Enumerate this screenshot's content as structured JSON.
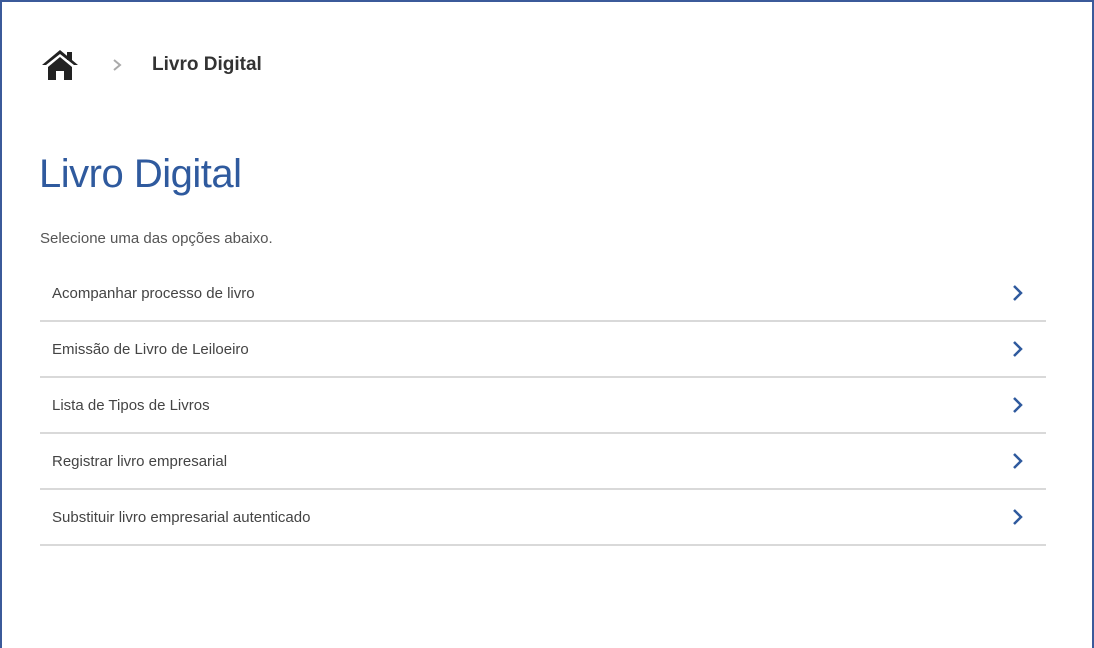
{
  "breadcrumb": {
    "home_icon": "home-icon",
    "separator_icon": "chevron-right-icon",
    "current": "Livro Digital"
  },
  "page": {
    "title": "Livro Digital",
    "subtitle": "Selecione uma das opções abaixo."
  },
  "options": [
    {
      "label": "Acompanhar processo de livro",
      "icon": "chevron-right-icon"
    },
    {
      "label": "Emissão de Livro de Leiloeiro",
      "icon": "chevron-right-icon"
    },
    {
      "label": "Lista de Tipos de Livros",
      "icon": "chevron-right-icon"
    },
    {
      "label": "Registrar livro empresarial",
      "icon": "chevron-right-icon"
    },
    {
      "label": "Substituir livro empresarial autenticado",
      "icon": "chevron-right-icon"
    }
  ],
  "colors": {
    "title": "#2f5a9e",
    "chevron": "#2f5a9e",
    "frame_border": "#3b5a9a",
    "divider": "#d9d9d9"
  }
}
